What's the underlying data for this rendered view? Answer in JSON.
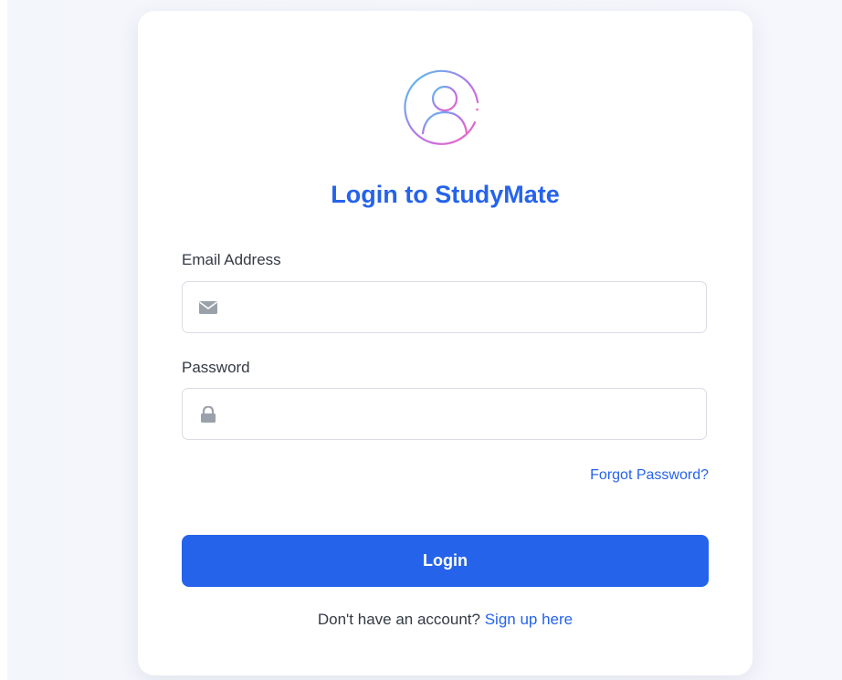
{
  "login_form": {
    "title": "Login to StudyMate",
    "avatar_icon": "user-circle-icon",
    "email": {
      "label": "Email Address",
      "value": "",
      "placeholder": "",
      "icon": "envelope-icon"
    },
    "password": {
      "label": "Password",
      "value": "",
      "placeholder": "",
      "icon": "lock-icon"
    },
    "forgot_password_label": "Forgot Password?",
    "submit_label": "Login",
    "signup_prompt": "Don't have an account?",
    "signup_link_label": "Sign up here"
  },
  "colors": {
    "accent": "#2563eb",
    "text": "#333a44",
    "border": "#d9dde3",
    "icon": "#9aa1ab",
    "avatar_gradient": [
      "#4cc7f0",
      "#b872e8",
      "#f066c0"
    ]
  }
}
